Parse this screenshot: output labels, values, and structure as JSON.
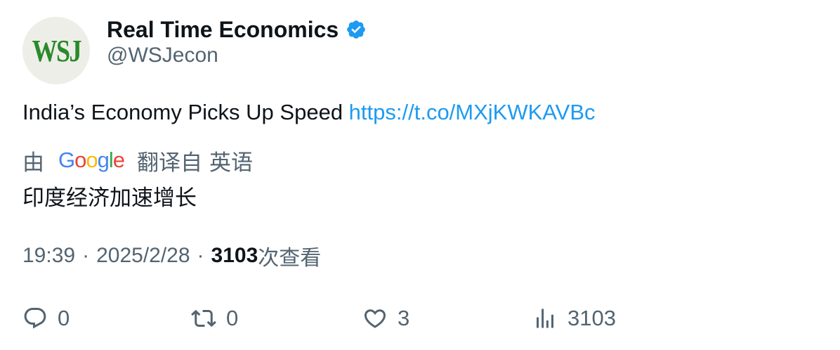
{
  "author": {
    "avatar_text": "WSJ",
    "display_name": "Real Time Economics",
    "handle": "@WSJecon",
    "verified_icon": "verified-badge-icon"
  },
  "tweet": {
    "text": "India’s Economy Picks Up Speed ",
    "link": "https://t.co/MXjKWKAVBc"
  },
  "translation": {
    "by": "由",
    "google_letters": [
      "G",
      "o",
      "o",
      "g",
      "l",
      "e"
    ],
    "translated_from": "翻译自",
    "language": "英语",
    "text": "印度经济加速增长"
  },
  "meta": {
    "time": "19:39",
    "separator": "·",
    "date": "2025/2/28",
    "views": "3103",
    "views_suffix": "次查看"
  },
  "actions": {
    "reply_count": "0",
    "retweet_count": "0",
    "like_count": "3",
    "views_count": "3103"
  },
  "colors": {
    "text_primary": "#0f1419",
    "text_secondary": "#536471",
    "link": "#1d9bf0",
    "verified": "#1d9bf0",
    "wsj_green": "#2a8a2a",
    "google_blue": "#4285f4",
    "google_red": "#ea4335",
    "google_yellow": "#fbbc05",
    "google_green": "#34a853"
  }
}
